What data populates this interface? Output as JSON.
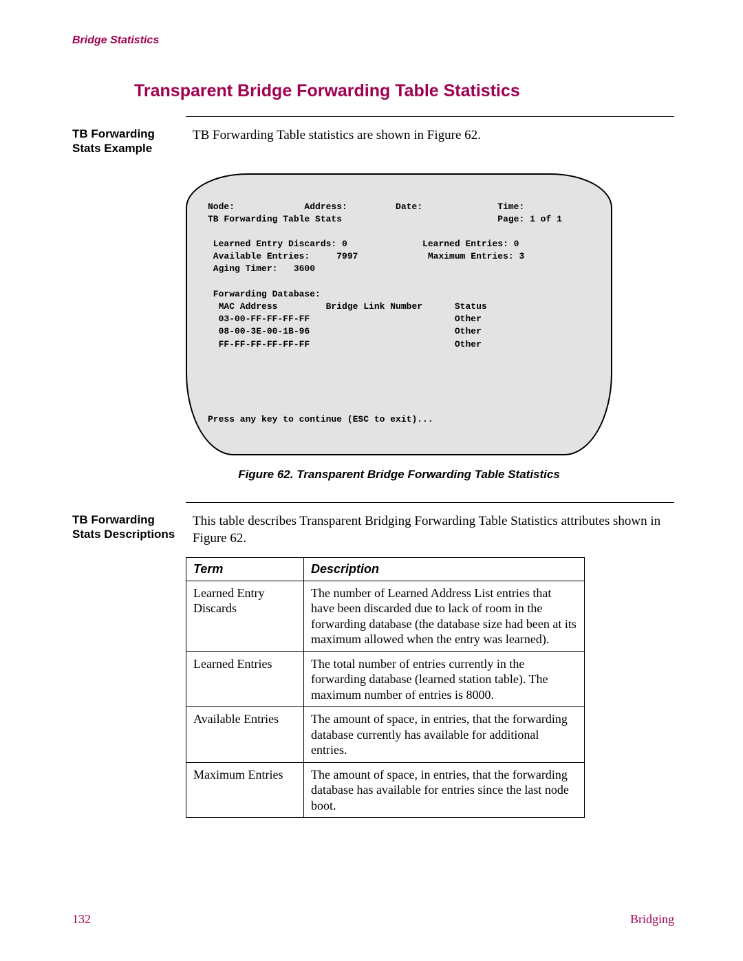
{
  "header": {
    "running": "Bridge Statistics"
  },
  "title": "Transparent Bridge Forwarding Table Statistics",
  "example": {
    "side_label": "TB Forwarding Stats Example",
    "intro": "TB Forwarding Table statistics are shown in Figure 62."
  },
  "terminal": {
    "line1": "Node:             Address:         Date:              Time:",
    "line2": "TB Forwarding Table Stats                             Page: 1 of 1",
    "blank1": "",
    "line3": " Learned Entry Discards: 0              Learned Entries: 0",
    "line4": " Available Entries:     7997             Maximum Entries: 3",
    "line5": " Aging Timer:   3600",
    "blank2": "",
    "line6": " Forwarding Database:",
    "line7": "  MAC Address         Bridge Link Number      Status",
    "line8": "  03-00-FF-FF-FF-FF                           Other",
    "line9": "  08-00-3E-00-1B-96                           Other",
    "line10": "  FF-FF-FF-FF-FF-FF                           Other",
    "blank3": "",
    "blank4": "",
    "blank5": "",
    "blank6": "",
    "blank7": "",
    "prompt": "Press any key to continue (ESC to exit)..."
  },
  "figure_caption": "Figure 62. Transparent Bridge Forwarding Table Statistics",
  "descriptions": {
    "side_label": "TB Forwarding Stats Descriptions",
    "intro": "This table describes Transparent Bridging Forwarding Table Statistics attributes shown in Figure 62.",
    "headers": {
      "term": "Term",
      "desc": "Description"
    },
    "rows": [
      {
        "term": "Learned Entry Discards",
        "desc": "The number of Learned Address List entries that have been discarded due to lack of room in the forwarding database (the database size had been at its maximum allowed when the entry was learned)."
      },
      {
        "term": "Learned Entries",
        "desc": "The total number of entries currently in the forwarding database (learned station table). The maximum number of entries is 8000."
      },
      {
        "term": "Available Entries",
        "desc": "The amount of space, in entries, that the forwarding database currently has available for additional entries."
      },
      {
        "term": "Maximum Entries",
        "desc": "The amount of space, in entries, that the forwarding database has available for entries since the last node boot."
      }
    ]
  },
  "footer": {
    "page": "132",
    "chapter": "Bridging"
  }
}
